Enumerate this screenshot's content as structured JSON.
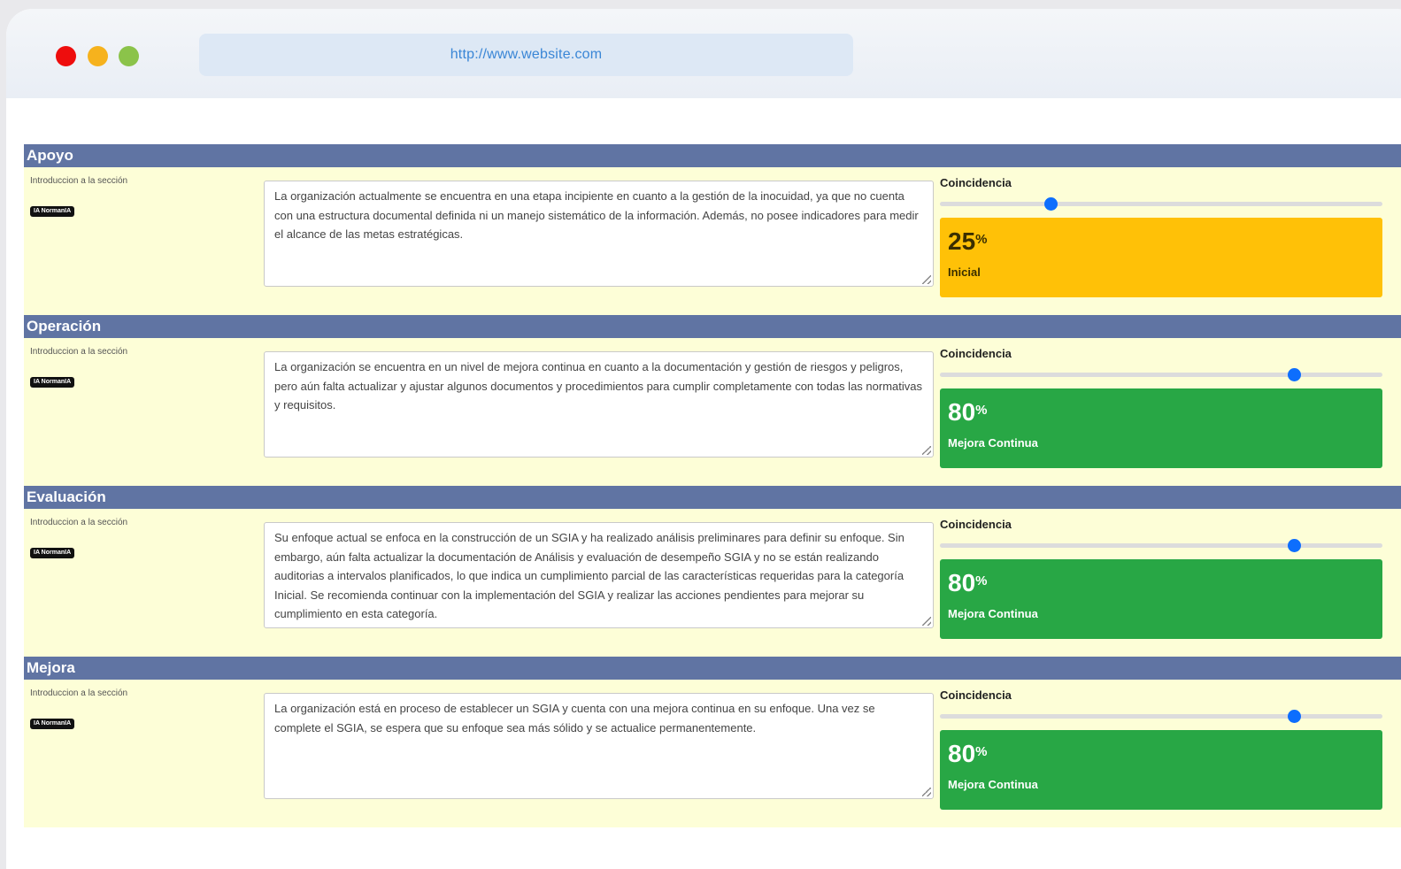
{
  "browser": {
    "url": "http://www.website.com"
  },
  "sections": [
    {
      "title": "Apoyo",
      "intro_label": "Introduccion a la sección",
      "badge": "IA NormanIA",
      "text": "La organización actualmente se encuentra en una etapa incipiente en cuanto a la gestión de la inocuidad, ya que no cuenta con una estructura documental definida ni un manejo sistemático de la información. Además, no posee indicadores para medir el alcance de las metas estratégicas.",
      "coincidence_label": "Coincidencia",
      "slider_fraction": 0.25,
      "percent": "25",
      "percent_symbol": "%",
      "level": "Inicial",
      "color": "#ffc107"
    },
    {
      "title": "Operación",
      "intro_label": "Introduccion a la sección",
      "badge": "IA NormanIA",
      "text": "La organización se encuentra en un nivel de mejora continua en cuanto a la documentación y gestión de riesgos y peligros, pero aún falta actualizar y ajustar algunos documentos y procedimientos para cumplir completamente con todas las normativas y requisitos.",
      "coincidence_label": "Coincidencia",
      "slider_fraction": 0.8,
      "percent": "80",
      "percent_symbol": "%",
      "level": "Mejora Continua",
      "color": "#28a745"
    },
    {
      "title": "Evaluación",
      "intro_label": "Introduccion a la sección",
      "badge": "IA NormanIA",
      "text": "Su enfoque actual se enfoca en la construcción de un SGIA y ha realizado análisis preliminares para definir su enfoque. Sin embargo, aún falta actualizar la documentación de Análisis y evaluación de desempeño SGIA y no se están realizando auditorias a intervalos planificados, lo que indica un cumplimiento parcial de las características requeridas para la categoría Inicial. Se recomienda continuar con la implementación del SGIA y realizar las acciones pendientes para mejorar su cumplimiento en esta categoría.",
      "coincidence_label": "Coincidencia",
      "slider_fraction": 0.8,
      "percent": "80",
      "percent_symbol": "%",
      "level": "Mejora Continua",
      "color": "#28a745"
    },
    {
      "title": "Mejora",
      "intro_label": "Introduccion a la sección",
      "badge": "IA NormanIA",
      "text": "La organización está en proceso de establecer un SGIA y cuenta con una mejora continua en su enfoque. Una vez se complete el SGIA, se espera que su enfoque sea más sólido y se actualice permanentemente.",
      "coincidence_label": "Coincidencia",
      "slider_fraction": 0.8,
      "percent": "80",
      "percent_symbol": "%",
      "level": "Mejora Continua",
      "color": "#28a745"
    }
  ]
}
